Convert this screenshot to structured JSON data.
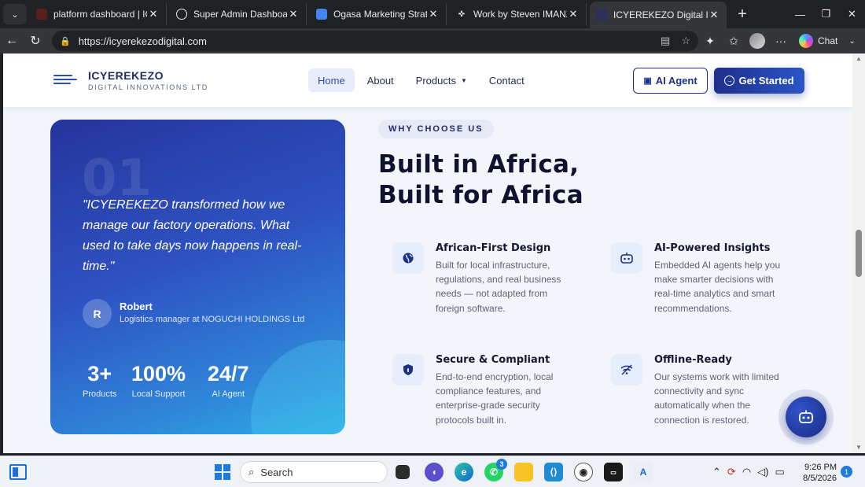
{
  "browser": {
    "tabs": [
      {
        "title": "platform dashboard | ICYEREKEZO",
        "favicon_color": "#5a1f1f",
        "active": false
      },
      {
        "title": "Super Admin Dashboard - Local",
        "favicon_color": "#e8eaed",
        "active": false
      },
      {
        "title": "Ogasa Marketing Strategy Proposal",
        "favicon_color": "#4285f4",
        "active": false
      },
      {
        "title": "Work by Steven IMANZI",
        "favicon_color": "#e8eaed",
        "active": false
      },
      {
        "title": "ICYEREKEZO Digital Innovations",
        "favicon_color": "#2a2f5c",
        "active": true
      }
    ],
    "url": "https://icyerekezodigital.com",
    "chat_label": "Chat"
  },
  "site": {
    "brand_name": "ICYEREKEZO",
    "brand_sub": "DIGITAL INNOVATIONS LTD",
    "nav": [
      {
        "label": "Home",
        "active": true
      },
      {
        "label": "About",
        "active": false
      },
      {
        "label": "Products",
        "active": false,
        "dropdown": true
      },
      {
        "label": "Contact",
        "active": false
      }
    ],
    "ai_agent_label": "AI Agent",
    "get_started_label": "Get Started"
  },
  "testimonial": {
    "index": "01",
    "quote": "\"ICYEREKEZO transformed how we manage our factory operations. What used to take days now happens in real-time.\"",
    "initial": "R",
    "name": "Robert",
    "role": "Logistics manager at NOGUCHI HOLDINGS Ltd",
    "stats": [
      {
        "value": "3+",
        "label": "Products"
      },
      {
        "value": "100%",
        "label": "Local Support"
      },
      {
        "value": "24/7",
        "label": "AI Agent"
      }
    ]
  },
  "why": {
    "pill": "WHY CHOOSE US",
    "heading_line1": "Built in Africa,",
    "heading_line2": "Built for Africa",
    "features": [
      {
        "icon": "globe-icon",
        "title": "African-First Design",
        "desc": "Built for local infrastructure, regulations, and real business needs — not adapted from foreign software."
      },
      {
        "icon": "robot-icon",
        "title": "AI-Powered Insights",
        "desc": "Embedded AI agents help you make smarter decisions with real-time analytics and smart recommendations."
      },
      {
        "icon": "shield-icon",
        "title": "Secure & Compliant",
        "desc": "End-to-end encryption, local compliance features, and enterprise-grade security protocols built in."
      },
      {
        "icon": "wifi-off-icon",
        "title": "Offline-Ready",
        "desc": "Our systems work with limited connectivity and sync automatically when the connection is restored."
      }
    ]
  },
  "taskbar": {
    "search_placeholder": "Search",
    "whatsapp_badge": "3",
    "time": "9:26 PM",
    "date": "8/5/2026",
    "notification_count": "1"
  },
  "colors": {
    "brand_navy": "#1e2f8a",
    "accent_blue": "#2a55c8",
    "page_bg": "#f3f5fb"
  }
}
